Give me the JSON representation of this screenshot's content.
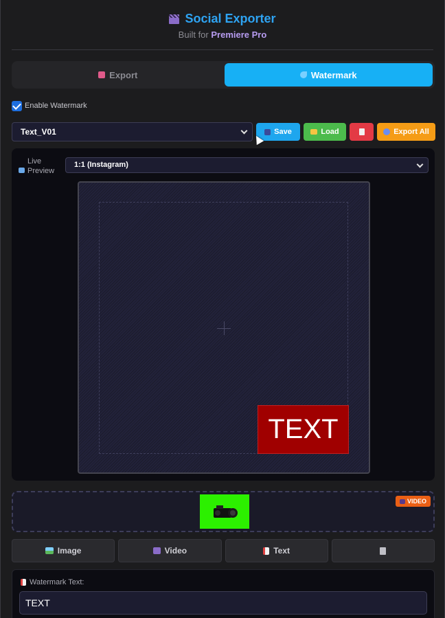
{
  "header": {
    "title": "Social Exporter",
    "subtitle_prefix": "Built for",
    "subtitle_app": "Premiere Pro"
  },
  "tabs": [
    {
      "label": "Export",
      "active": false
    },
    {
      "label": "Watermark",
      "active": true
    }
  ],
  "enable_watermark": {
    "label": "Enable Watermark",
    "checked": true
  },
  "preset": {
    "selected": "Text_V01",
    "save_label": "Save",
    "load_label": "Load",
    "export_all_label": "Export All"
  },
  "preview": {
    "label": "Live Preview",
    "aspect_selected": "1:1 (Instagram)",
    "watermark_text": "TEXT"
  },
  "media": {
    "badge_label": "VIDEO"
  },
  "types": [
    {
      "label": "Image",
      "icon": "image-icon"
    },
    {
      "label": "Video",
      "icon": "clapper-icon"
    },
    {
      "label": "Text",
      "icon": "document-icon"
    },
    {
      "label": "",
      "icon": "trash-icon"
    }
  ],
  "text_input": {
    "label": "Watermark Text:",
    "value": "TEXT"
  },
  "colors": {
    "accent": "#17b0f5",
    "save": "#1ea6ee",
    "load": "#4cbb4c",
    "delete": "#e33a45",
    "export_all": "#f59c16",
    "watermark_bg": "#a00000",
    "video_badge": "#ea5f15"
  }
}
